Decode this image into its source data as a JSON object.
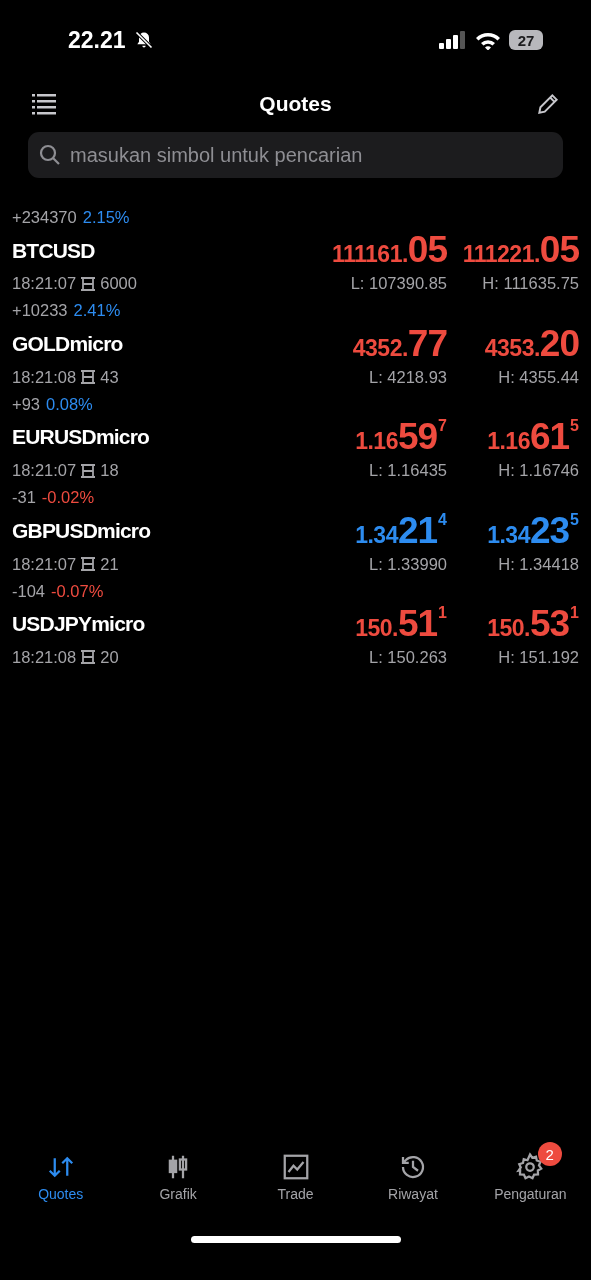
{
  "status_bar": {
    "time": "22.21",
    "battery": "27"
  },
  "header": {
    "title": "Quotes"
  },
  "search": {
    "placeholder": "masukan simbol untuk pencarian"
  },
  "quotes": [
    {
      "change": "+234370",
      "percent": "2.15%",
      "percent_rising": true,
      "symbol": "BTCUSD",
      "time": "18:21:07",
      "spread": "6000",
      "price_rising": false,
      "bid": {
        "small": "111161.",
        "big": "05"
      },
      "ask": {
        "small": "111221.",
        "big": "05"
      },
      "low": "L: 107390.85",
      "high": "H: 111635.75"
    },
    {
      "change": "+10233",
      "percent": "2.41%",
      "percent_rising": true,
      "symbol": "GOLDmicro",
      "time": "18:21:08",
      "spread": "43",
      "price_rising": false,
      "bid": {
        "small": "4352.",
        "big": "77"
      },
      "ask": {
        "small": "4353.",
        "big": "20"
      },
      "low": "L: 4218.93",
      "high": "H: 4355.44"
    },
    {
      "change": "+93",
      "percent": "0.08%",
      "percent_rising": true,
      "symbol": "EURUSDmicro",
      "time": "18:21:07",
      "spread": "18",
      "price_rising": false,
      "bid": {
        "small": "1.16",
        "big": "59",
        "sup": "7"
      },
      "ask": {
        "small": "1.16",
        "big": "61",
        "sup": "5"
      },
      "low": "L: 1.16435",
      "high": "H: 1.16746"
    },
    {
      "change": "-31",
      "percent": "-0.02%",
      "percent_rising": false,
      "symbol": "GBPUSDmicro",
      "time": "18:21:07",
      "spread": "21",
      "price_rising": true,
      "bid": {
        "small": "1.34",
        "big": "21",
        "sup": "4"
      },
      "ask": {
        "small": "1.34",
        "big": "23",
        "sup": "5"
      },
      "low": "L: 1.33990",
      "high": "H: 1.34418"
    },
    {
      "change": "-104",
      "percent": "-0.07%",
      "percent_rising": false,
      "symbol": "USDJPYmicro",
      "time": "18:21:08",
      "spread": "20",
      "price_rising": false,
      "bid": {
        "small": "150.",
        "big": "51",
        "sup": "1"
      },
      "ask": {
        "small": "150.",
        "big": "53",
        "sup": "1"
      },
      "low": "L: 150.263",
      "high": "H: 151.192"
    }
  ],
  "tabs": [
    {
      "label": "Quotes",
      "kind": "quotes",
      "selected": true
    },
    {
      "label": "Grafik",
      "kind": "chart",
      "selected": false
    },
    {
      "label": "Trade",
      "kind": "trade",
      "selected": false
    },
    {
      "label": "Riwayat",
      "kind": "history",
      "selected": false
    },
    {
      "label": "Pengaturan",
      "kind": "settings",
      "selected": false,
      "badge": "2"
    }
  ]
}
